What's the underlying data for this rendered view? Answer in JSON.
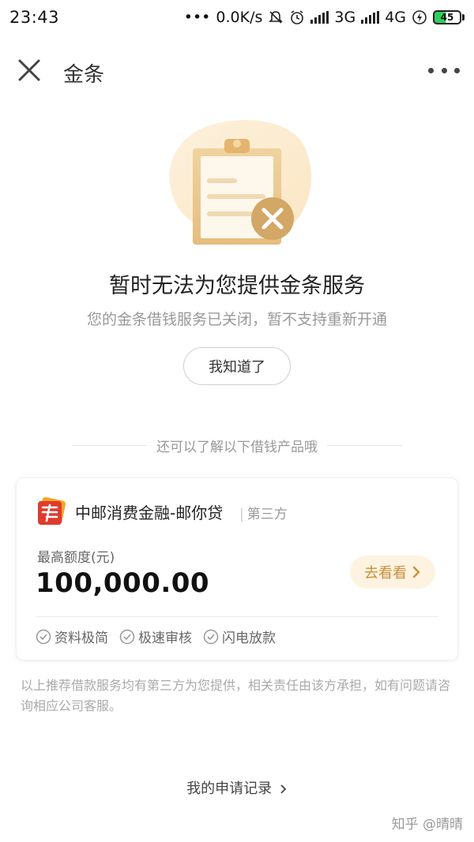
{
  "status_bar": {
    "time": "23:43",
    "network_speed": "0.0K/s",
    "net1": "3G",
    "net2": "4G",
    "battery": "45",
    "icons": [
      "dots-icon",
      "mute-icon",
      "alarm-icon",
      "signal-icon",
      "signal-icon",
      "charging-icon",
      "battery-icon"
    ]
  },
  "nav": {
    "title": "金条",
    "close_icon": "close-icon",
    "more_icon": "more-icon"
  },
  "notice": {
    "title": "暂时无法为您提供金条服务",
    "subtitle": "您的金条借钱服务已关闭，暂不支持重新开通",
    "ack_button": "我知道了"
  },
  "section": {
    "divider_text": "还可以了解以下借钱产品哦"
  },
  "product": {
    "name": "中邮消费金融-邮你贷",
    "tag": "第三方",
    "limit_label": "最高额度(元)",
    "limit_value": "100,000.00",
    "go_button": "去看看",
    "features": [
      "资料极简",
      "极速审核",
      "闪电放款"
    ],
    "accent_color": "#c8903b",
    "logo_color": "#e03a2e"
  },
  "disclaimer": "以上推荐借款服务均有第三方为您提供，相关责任由该方承担，如有问题请咨询相应公司客服。",
  "records_link": "我的申请记录",
  "watermark": "知乎 @晴晴"
}
